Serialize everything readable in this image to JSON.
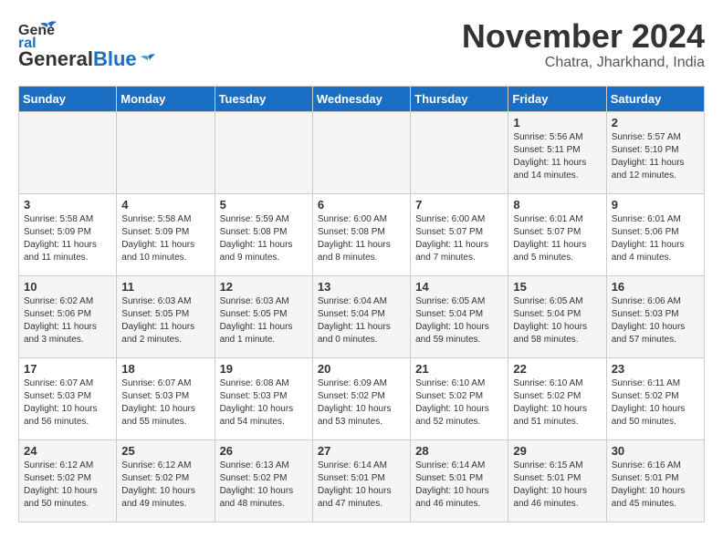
{
  "header": {
    "logo_line1": "General",
    "logo_line2": "Blue",
    "month": "November 2024",
    "location": "Chatra, Jharkhand, India"
  },
  "weekdays": [
    "Sunday",
    "Monday",
    "Tuesday",
    "Wednesday",
    "Thursday",
    "Friday",
    "Saturday"
  ],
  "weeks": [
    [
      {
        "day": "",
        "info": ""
      },
      {
        "day": "",
        "info": ""
      },
      {
        "day": "",
        "info": ""
      },
      {
        "day": "",
        "info": ""
      },
      {
        "day": "",
        "info": ""
      },
      {
        "day": "1",
        "info": "Sunrise: 5:56 AM\nSunset: 5:11 PM\nDaylight: 11 hours and 14 minutes."
      },
      {
        "day": "2",
        "info": "Sunrise: 5:57 AM\nSunset: 5:10 PM\nDaylight: 11 hours and 12 minutes."
      }
    ],
    [
      {
        "day": "3",
        "info": "Sunrise: 5:58 AM\nSunset: 5:09 PM\nDaylight: 11 hours and 11 minutes."
      },
      {
        "day": "4",
        "info": "Sunrise: 5:58 AM\nSunset: 5:09 PM\nDaylight: 11 hours and 10 minutes."
      },
      {
        "day": "5",
        "info": "Sunrise: 5:59 AM\nSunset: 5:08 PM\nDaylight: 11 hours and 9 minutes."
      },
      {
        "day": "6",
        "info": "Sunrise: 6:00 AM\nSunset: 5:08 PM\nDaylight: 11 hours and 8 minutes."
      },
      {
        "day": "7",
        "info": "Sunrise: 6:00 AM\nSunset: 5:07 PM\nDaylight: 11 hours and 7 minutes."
      },
      {
        "day": "8",
        "info": "Sunrise: 6:01 AM\nSunset: 5:07 PM\nDaylight: 11 hours and 5 minutes."
      },
      {
        "day": "9",
        "info": "Sunrise: 6:01 AM\nSunset: 5:06 PM\nDaylight: 11 hours and 4 minutes."
      }
    ],
    [
      {
        "day": "10",
        "info": "Sunrise: 6:02 AM\nSunset: 5:06 PM\nDaylight: 11 hours and 3 minutes."
      },
      {
        "day": "11",
        "info": "Sunrise: 6:03 AM\nSunset: 5:05 PM\nDaylight: 11 hours and 2 minutes."
      },
      {
        "day": "12",
        "info": "Sunrise: 6:03 AM\nSunset: 5:05 PM\nDaylight: 11 hours and 1 minute."
      },
      {
        "day": "13",
        "info": "Sunrise: 6:04 AM\nSunset: 5:04 PM\nDaylight: 11 hours and 0 minutes."
      },
      {
        "day": "14",
        "info": "Sunrise: 6:05 AM\nSunset: 5:04 PM\nDaylight: 10 hours and 59 minutes."
      },
      {
        "day": "15",
        "info": "Sunrise: 6:05 AM\nSunset: 5:04 PM\nDaylight: 10 hours and 58 minutes."
      },
      {
        "day": "16",
        "info": "Sunrise: 6:06 AM\nSunset: 5:03 PM\nDaylight: 10 hours and 57 minutes."
      }
    ],
    [
      {
        "day": "17",
        "info": "Sunrise: 6:07 AM\nSunset: 5:03 PM\nDaylight: 10 hours and 56 minutes."
      },
      {
        "day": "18",
        "info": "Sunrise: 6:07 AM\nSunset: 5:03 PM\nDaylight: 10 hours and 55 minutes."
      },
      {
        "day": "19",
        "info": "Sunrise: 6:08 AM\nSunset: 5:03 PM\nDaylight: 10 hours and 54 minutes."
      },
      {
        "day": "20",
        "info": "Sunrise: 6:09 AM\nSunset: 5:02 PM\nDaylight: 10 hours and 53 minutes."
      },
      {
        "day": "21",
        "info": "Sunrise: 6:10 AM\nSunset: 5:02 PM\nDaylight: 10 hours and 52 minutes."
      },
      {
        "day": "22",
        "info": "Sunrise: 6:10 AM\nSunset: 5:02 PM\nDaylight: 10 hours and 51 minutes."
      },
      {
        "day": "23",
        "info": "Sunrise: 6:11 AM\nSunset: 5:02 PM\nDaylight: 10 hours and 50 minutes."
      }
    ],
    [
      {
        "day": "24",
        "info": "Sunrise: 6:12 AM\nSunset: 5:02 PM\nDaylight: 10 hours and 50 minutes."
      },
      {
        "day": "25",
        "info": "Sunrise: 6:12 AM\nSunset: 5:02 PM\nDaylight: 10 hours and 49 minutes."
      },
      {
        "day": "26",
        "info": "Sunrise: 6:13 AM\nSunset: 5:02 PM\nDaylight: 10 hours and 48 minutes."
      },
      {
        "day": "27",
        "info": "Sunrise: 6:14 AM\nSunset: 5:01 PM\nDaylight: 10 hours and 47 minutes."
      },
      {
        "day": "28",
        "info": "Sunrise: 6:14 AM\nSunset: 5:01 PM\nDaylight: 10 hours and 46 minutes."
      },
      {
        "day": "29",
        "info": "Sunrise: 6:15 AM\nSunset: 5:01 PM\nDaylight: 10 hours and 46 minutes."
      },
      {
        "day": "30",
        "info": "Sunrise: 6:16 AM\nSunset: 5:01 PM\nDaylight: 10 hours and 45 minutes."
      }
    ]
  ]
}
